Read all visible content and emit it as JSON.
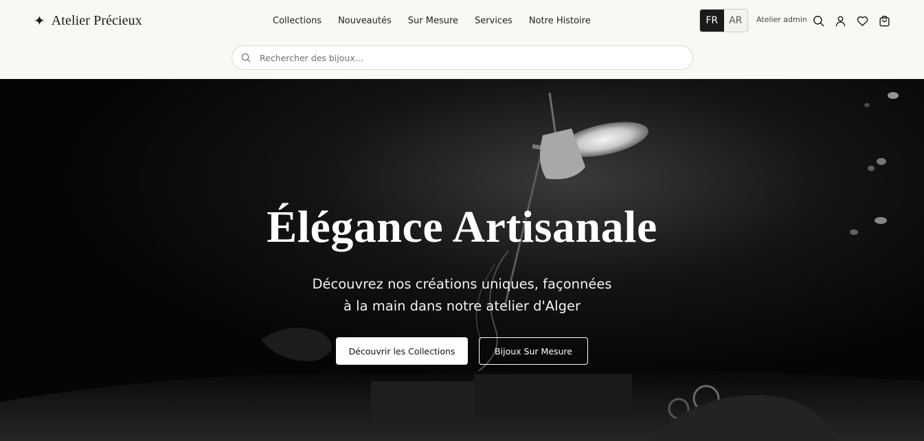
{
  "brand": {
    "logo_glyph": "✦",
    "name": "Atelier Précieux"
  },
  "nav": {
    "items": [
      {
        "label": "Collections"
      },
      {
        "label": "Nouveautés"
      },
      {
        "label": "Sur Mesure"
      },
      {
        "label": "Services"
      },
      {
        "label": "Notre Histoire"
      }
    ]
  },
  "language": {
    "options": [
      "FR",
      "AR"
    ],
    "selected": "FR"
  },
  "account": {
    "admin_label": "Atelier admin"
  },
  "header_icons": [
    "search-icon",
    "user-icon",
    "heart-icon",
    "cart-icon"
  ],
  "search": {
    "placeholder": "Rechercher des bijoux...",
    "value": ""
  },
  "hero": {
    "title": "Élégance Artisanale",
    "subtitle_line1": "Découvrez nos créations uniques, façonnées",
    "subtitle_line2": "à la main dans notre atelier d'Alger",
    "primary_cta": "Découvrir les Collections",
    "secondary_cta": "Bijoux Sur Mesure"
  },
  "colors": {
    "header_bg": "#faf8f3",
    "hero_bg": "#050505",
    "text_dark": "#1a1a1a",
    "active_lang_bg": "#1a1a1a"
  }
}
